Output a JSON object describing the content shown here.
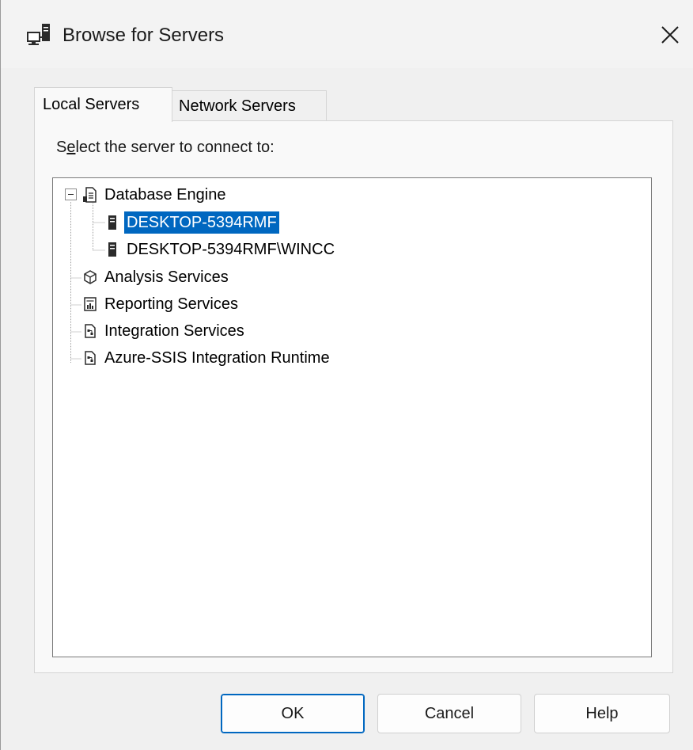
{
  "window": {
    "title": "Browse for Servers",
    "icon": "server-network-icon",
    "close_icon": "close-icon"
  },
  "tabs": [
    {
      "label": "Local Servers",
      "selected": true
    },
    {
      "label": "Network Servers",
      "selected": false
    }
  ],
  "panel": {
    "prompt_before": "S",
    "prompt_accel": "e",
    "prompt_after": "lect the server to connect to:"
  },
  "tree": [
    {
      "label": "Database Engine",
      "icon": "database-engine-icon",
      "expanded": true,
      "children": [
        {
          "label": "DESKTOP-5394RMF",
          "icon": "server-icon",
          "selected": true
        },
        {
          "label": "DESKTOP-5394RMF\\WINCC",
          "icon": "server-icon",
          "selected": false
        }
      ]
    },
    {
      "label": "Analysis Services",
      "icon": "analysis-cube-icon"
    },
    {
      "label": "Reporting Services",
      "icon": "report-icon"
    },
    {
      "label": "Integration Services",
      "icon": "integration-icon"
    },
    {
      "label": "Azure-SSIS Integration Runtime",
      "icon": "integration-icon"
    }
  ],
  "buttons": {
    "ok": "OK",
    "cancel": "Cancel",
    "help": "Help"
  },
  "colors": {
    "selection": "#0067c0",
    "default_button_border": "#0067c0"
  }
}
